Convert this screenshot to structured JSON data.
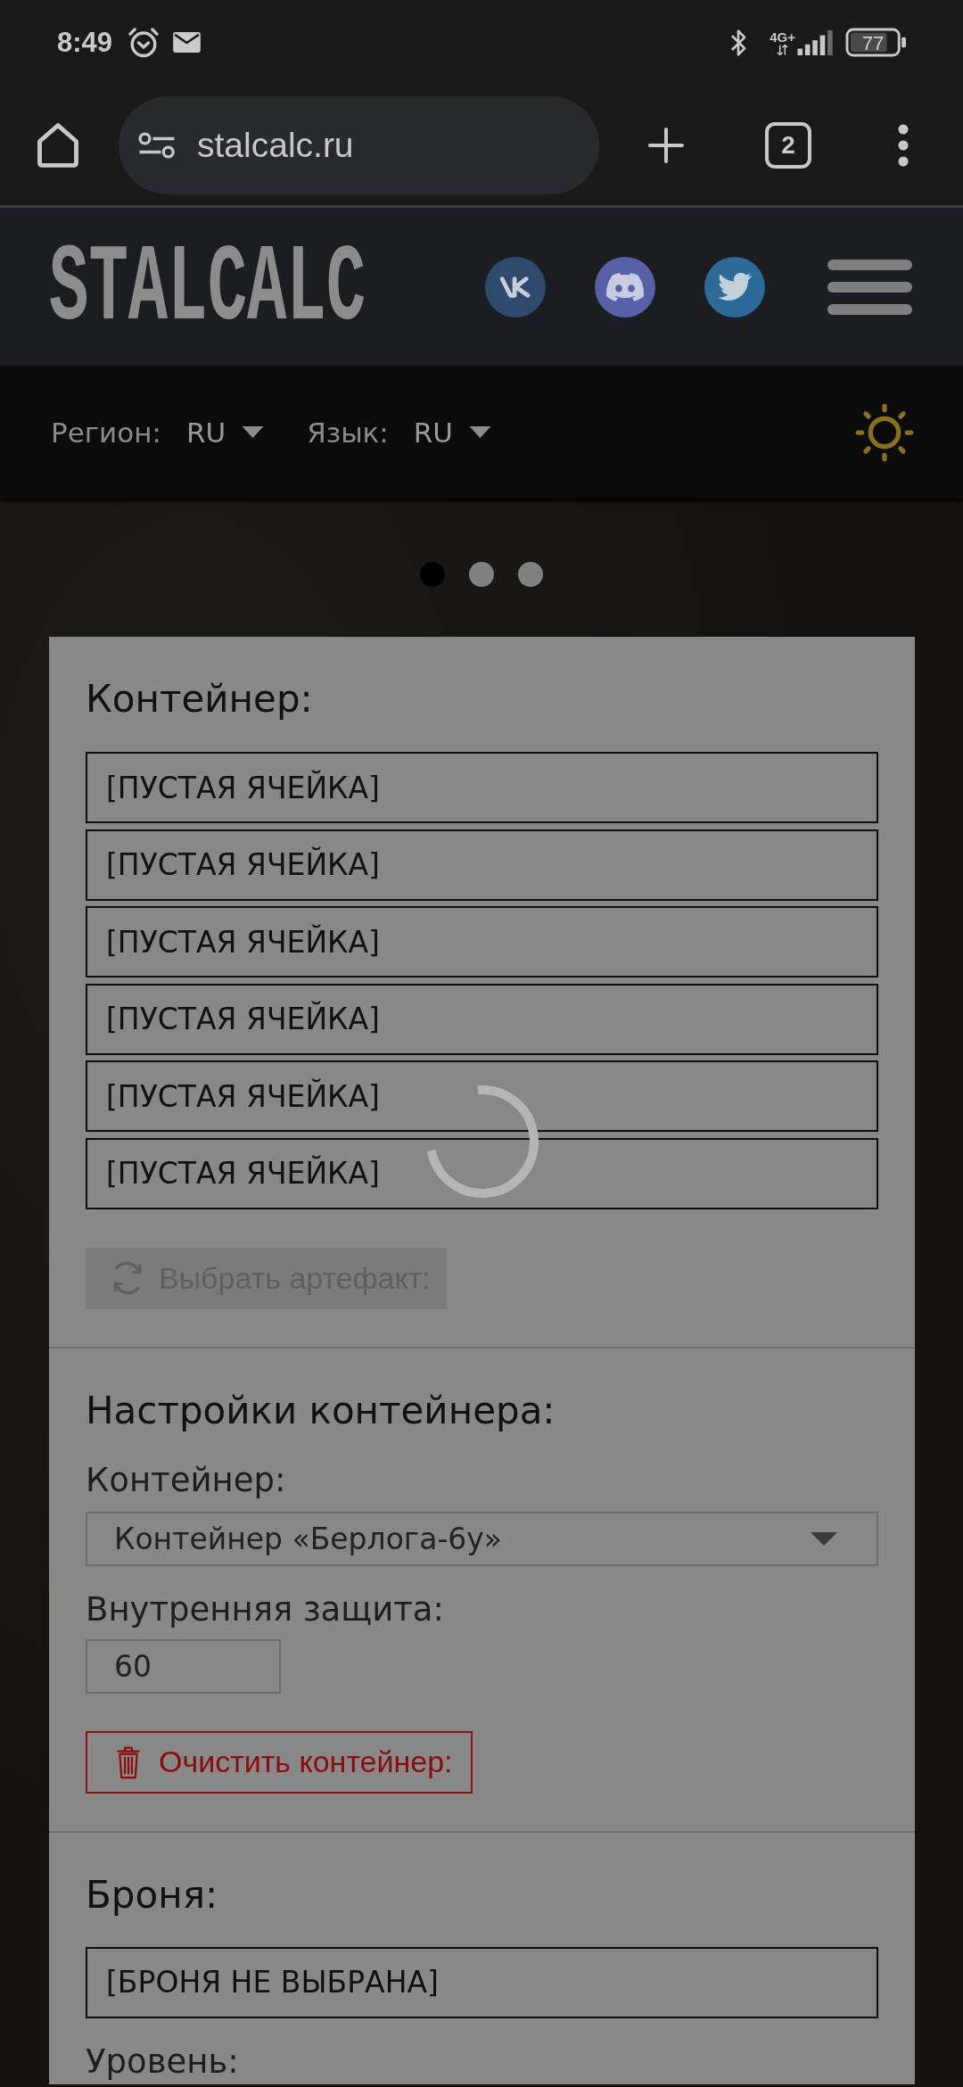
{
  "status_bar": {
    "time": "8:49",
    "network_type": "4G+",
    "battery": "77"
  },
  "browser_bar": {
    "url": "stalcalc.ru",
    "tab_count": "2"
  },
  "site_header": {
    "logo": "STALCALC",
    "social_links": [
      {
        "kind": "vk",
        "color": "#2e4a6c"
      },
      {
        "kind": "discord",
        "color": "#5761a8"
      },
      {
        "kind": "twitter",
        "color": "#2c6a9a"
      }
    ]
  },
  "preferences_bar": {
    "region_label": "Регион:",
    "region_value": "RU",
    "language_label": "Язык:",
    "language_value": "RU"
  },
  "carousel_dots": [
    {
      "selected": true
    },
    {
      "selected": false
    },
    {
      "selected": false
    }
  ],
  "loading": true,
  "container": {
    "title": "Контейнер:",
    "slots": [
      "[ПУСТАЯ ЯЧЕЙКА]",
      "[ПУСТАЯ ЯЧЕЙКА]",
      "[ПУСТАЯ ЯЧЕЙКА]",
      "[ПУСТАЯ ЯЧЕЙКА]",
      "[ПУСТАЯ ЯЧЕЙКА]",
      "[ПУСТАЯ ЯЧЕЙКА]"
    ],
    "pick_button": {
      "label": "Выбрать артефакт:",
      "disabled": true
    }
  },
  "container_settings": {
    "title": "Настройки контейнера:",
    "container_label": "Контейнер:",
    "container_value": "Контейнер «Берлога-6у»",
    "protection_label": "Внутренняя защита:",
    "protection_value": "60",
    "clear_button": "Очистить контейнер:"
  },
  "armor": {
    "title": "Броня:",
    "slot": "[БРОНЯ НЕ ВЫБРАНА]",
    "level_label": "Уровень:"
  }
}
